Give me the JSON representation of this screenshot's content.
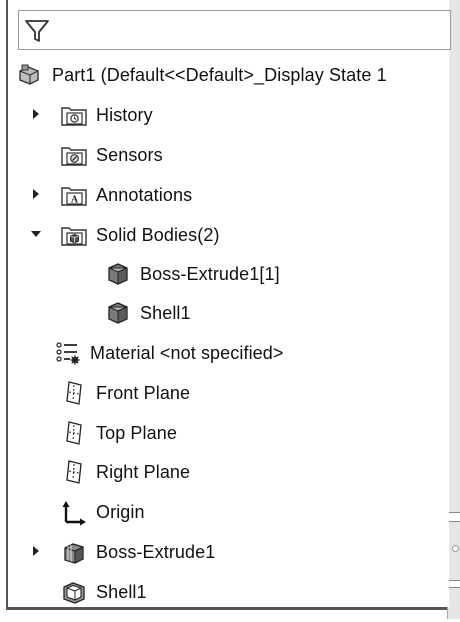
{
  "filter": {
    "placeholder": ""
  },
  "tree": {
    "root": {
      "label": "Part1  (Default<<Default>_Display State 1"
    },
    "items": [
      {
        "label": "History",
        "icon": "history-folder-icon",
        "expander": "collapsed"
      },
      {
        "label": "Sensors",
        "icon": "sensors-folder-icon",
        "expander": "none"
      },
      {
        "label": "Annotations",
        "icon": "annotations-folder-icon",
        "expander": "collapsed"
      },
      {
        "label": "Solid Bodies(2)",
        "icon": "solid-bodies-folder-icon",
        "expander": "expanded"
      },
      {
        "label": "Boss-Extrude1[1]",
        "icon": "solid-body-icon",
        "expander": "none"
      },
      {
        "label": "Shell1",
        "icon": "solid-body-icon",
        "expander": "none"
      },
      {
        "label": "Material <not specified>",
        "icon": "material-icon",
        "expander": "none"
      },
      {
        "label": "Front Plane",
        "icon": "plane-icon",
        "expander": "none"
      },
      {
        "label": "Top Plane",
        "icon": "plane-icon",
        "expander": "none"
      },
      {
        "label": "Right Plane",
        "icon": "plane-icon",
        "expander": "none"
      },
      {
        "label": "Origin",
        "icon": "origin-icon",
        "expander": "none"
      },
      {
        "label": "Boss-Extrude1",
        "icon": "extrude-feature-icon",
        "expander": "collapsed"
      },
      {
        "label": "Shell1",
        "icon": "shell-feature-icon",
        "expander": "none"
      }
    ]
  }
}
